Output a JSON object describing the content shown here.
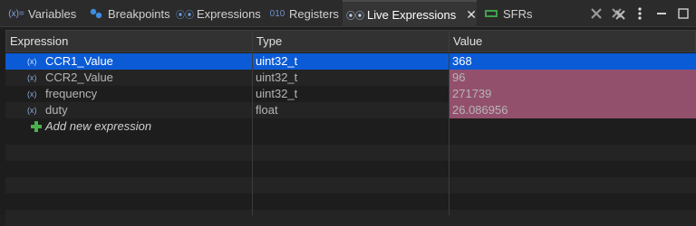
{
  "tabs": [
    {
      "label": "Variables",
      "icon": "variables-icon"
    },
    {
      "label": "Breakpoints",
      "icon": "breakpoints-icon"
    },
    {
      "label": "Expressions",
      "icon": "expressions-icon"
    },
    {
      "label": "Registers",
      "icon": "registers-icon"
    },
    {
      "label": "Live Expressions",
      "icon": "live-expressions-icon",
      "active": true
    },
    {
      "label": "SFRs",
      "icon": "sfrs-icon"
    }
  ],
  "columns": {
    "expression": "Expression",
    "type": "Type",
    "value": "Value"
  },
  "rows": [
    {
      "expression": "CCR1_Value",
      "type": "uint32_t",
      "value": "368",
      "selected": true
    },
    {
      "expression": "CCR2_Value",
      "type": "uint32_t",
      "value": "96"
    },
    {
      "expression": "frequency",
      "type": "uint32_t",
      "value": "271739"
    },
    {
      "expression": "duty",
      "type": "float",
      "value": "26.086956"
    }
  ],
  "add_expression": "Add new expression",
  "colors": {
    "selection": "#0b5bd6",
    "changed_value": "#93506d"
  }
}
